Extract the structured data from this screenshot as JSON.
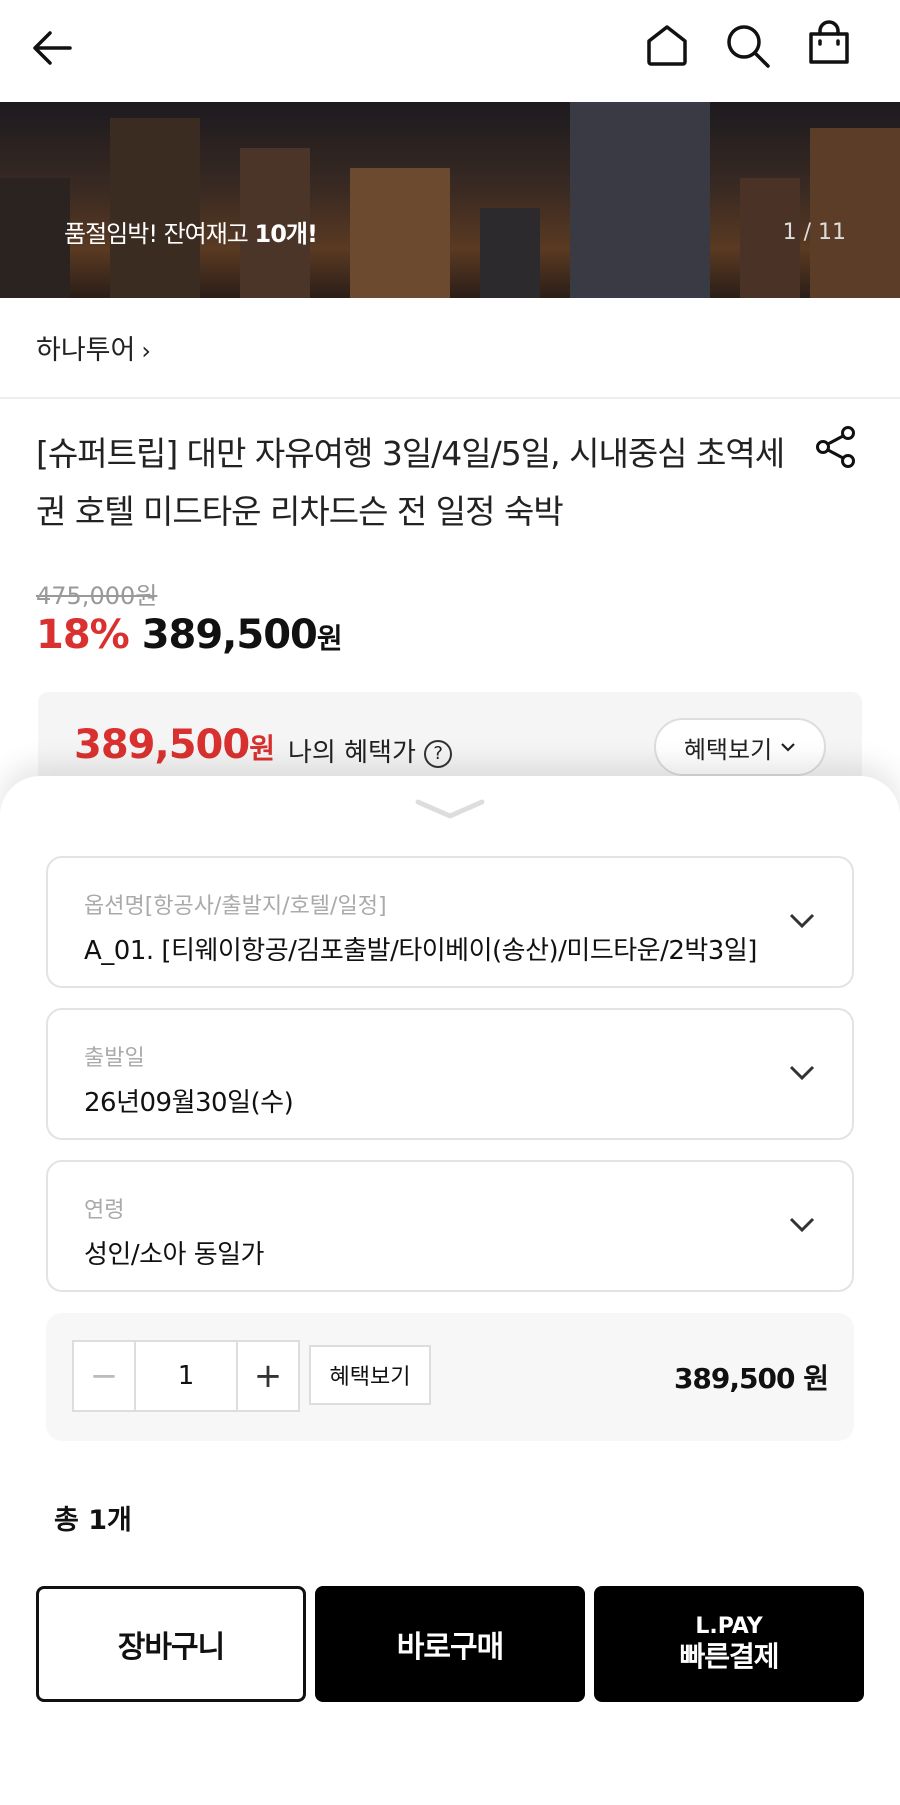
{
  "banner": {
    "text_prefix": "품절임박! 잔여재고 ",
    "text_bold": "10개!",
    "counter": "1 / 11"
  },
  "brand": {
    "name": "하나투어",
    "arrow": "›"
  },
  "product": {
    "title": "[슈퍼트립] 대만 자유여행 3일/4일/5일, 시내중심 초역세권 호텔 미드타운 리차드슨 전 일정 숙박",
    "original_price": "475,000원",
    "discount": "18%",
    "price": "389,500",
    "currency": "원"
  },
  "benefit_box": {
    "price": "389,500",
    "currency": "원",
    "label": "나의 혜택가",
    "help_icon": "?",
    "button": "혜택보기"
  },
  "options": [
    {
      "label": "옵션명[항공사/출발지/호텔/일정]",
      "value": "A_01. [티웨이항공/김포출발/타이베이(송산)/미드타운/2박3일]"
    },
    {
      "label": "출발일",
      "value": "26년09월30일(수)"
    },
    {
      "label": "연령",
      "value": "성인/소아 동일가"
    }
  ],
  "quantity": {
    "minus": "−",
    "value": "1",
    "plus": "+",
    "benefit_button": "혜택보기",
    "price": "389,500 원"
  },
  "total": "총 1개",
  "actions": {
    "cart": "장바구니",
    "buy": "바로구매",
    "lpay_top": "L.PAY",
    "lpay_bottom": "빠른결제"
  },
  "colors": {
    "accent_red": "#d8312f",
    "black": "#000000"
  },
  "icons": [
    "back-arrow-icon",
    "home-icon",
    "search-icon",
    "shopping-bag-icon",
    "share-icon",
    "help-circle-icon",
    "chevron-down-icon",
    "sheet-handle-icon"
  ]
}
